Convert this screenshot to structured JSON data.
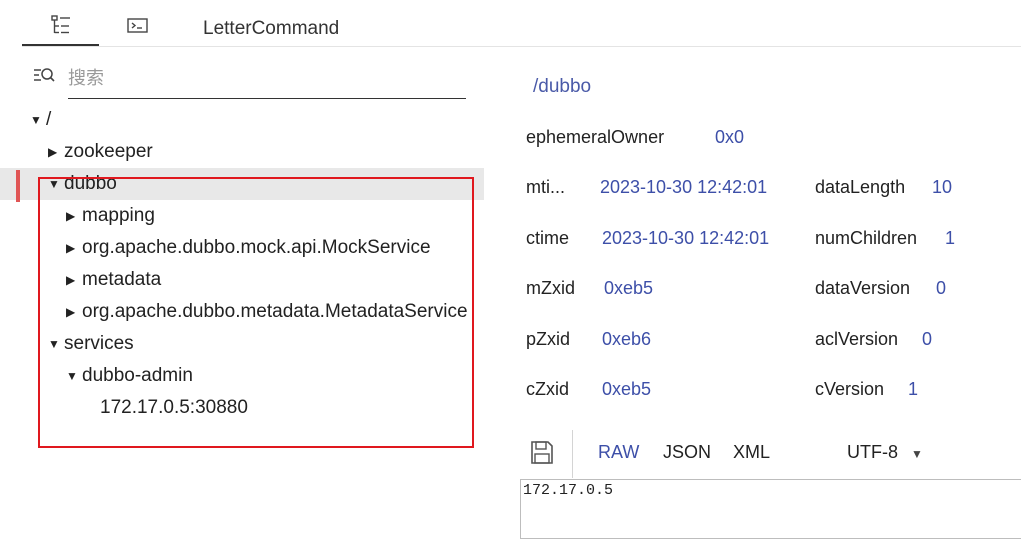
{
  "tabs": [
    {
      "icon": "tree-icon",
      "label": ""
    },
    {
      "icon": "terminal-icon",
      "label": ""
    },
    {
      "icon": "",
      "label": "LetterCommand"
    }
  ],
  "search": {
    "placeholder": "搜索",
    "value": ""
  },
  "tree": {
    "root": "/",
    "items": [
      {
        "label": "zookeeper",
        "expanded": false
      },
      {
        "label": "dubbo",
        "expanded": true,
        "selected": true
      },
      {
        "label": "mapping",
        "expanded": false
      },
      {
        "label": "org.apache.dubbo.mock.api.MockService",
        "expanded": false
      },
      {
        "label": "metadata",
        "expanded": false
      },
      {
        "label": "org.apache.dubbo.metadata.MetadataService",
        "expanded": false
      },
      {
        "label": "services",
        "expanded": true
      },
      {
        "label": "dubbo-admin",
        "expanded": true
      },
      {
        "label": "172.17.0.5:30880",
        "expanded": false
      }
    ]
  },
  "node": {
    "path": "/dubbo",
    "ephemeralOwner": {
      "key": "ephemeralOwner",
      "value": "0x0"
    },
    "mtime": {
      "key": "mti...",
      "value": "2023-10-30 12:42:01"
    },
    "dataLength": {
      "key": "dataLength",
      "value": "10"
    },
    "ctime": {
      "key": "ctime",
      "value": "2023-10-30 12:42:01"
    },
    "numChildren": {
      "key": "numChildren",
      "value": "1"
    },
    "mZxid": {
      "key": "mZxid",
      "value": "0xeb5"
    },
    "dataVersion": {
      "key": "dataVersion",
      "value": "0"
    },
    "pZxid": {
      "key": "pZxid",
      "value": "0xeb6"
    },
    "aclVersion": {
      "key": "aclVersion",
      "value": "0"
    },
    "cZxid": {
      "key": "cZxid",
      "value": "0xeb5"
    },
    "cVersion": {
      "key": "cVersion",
      "value": "1"
    }
  },
  "toolbar": {
    "formats": [
      "RAW",
      "JSON",
      "XML"
    ],
    "active_format": "RAW",
    "encoding": "UTF-8"
  },
  "data_content": "172.17.0.5",
  "colors": {
    "accent": "#3d4fa8",
    "highlight_border": "#e0181e",
    "selected_bg": "#e8e8e8"
  }
}
